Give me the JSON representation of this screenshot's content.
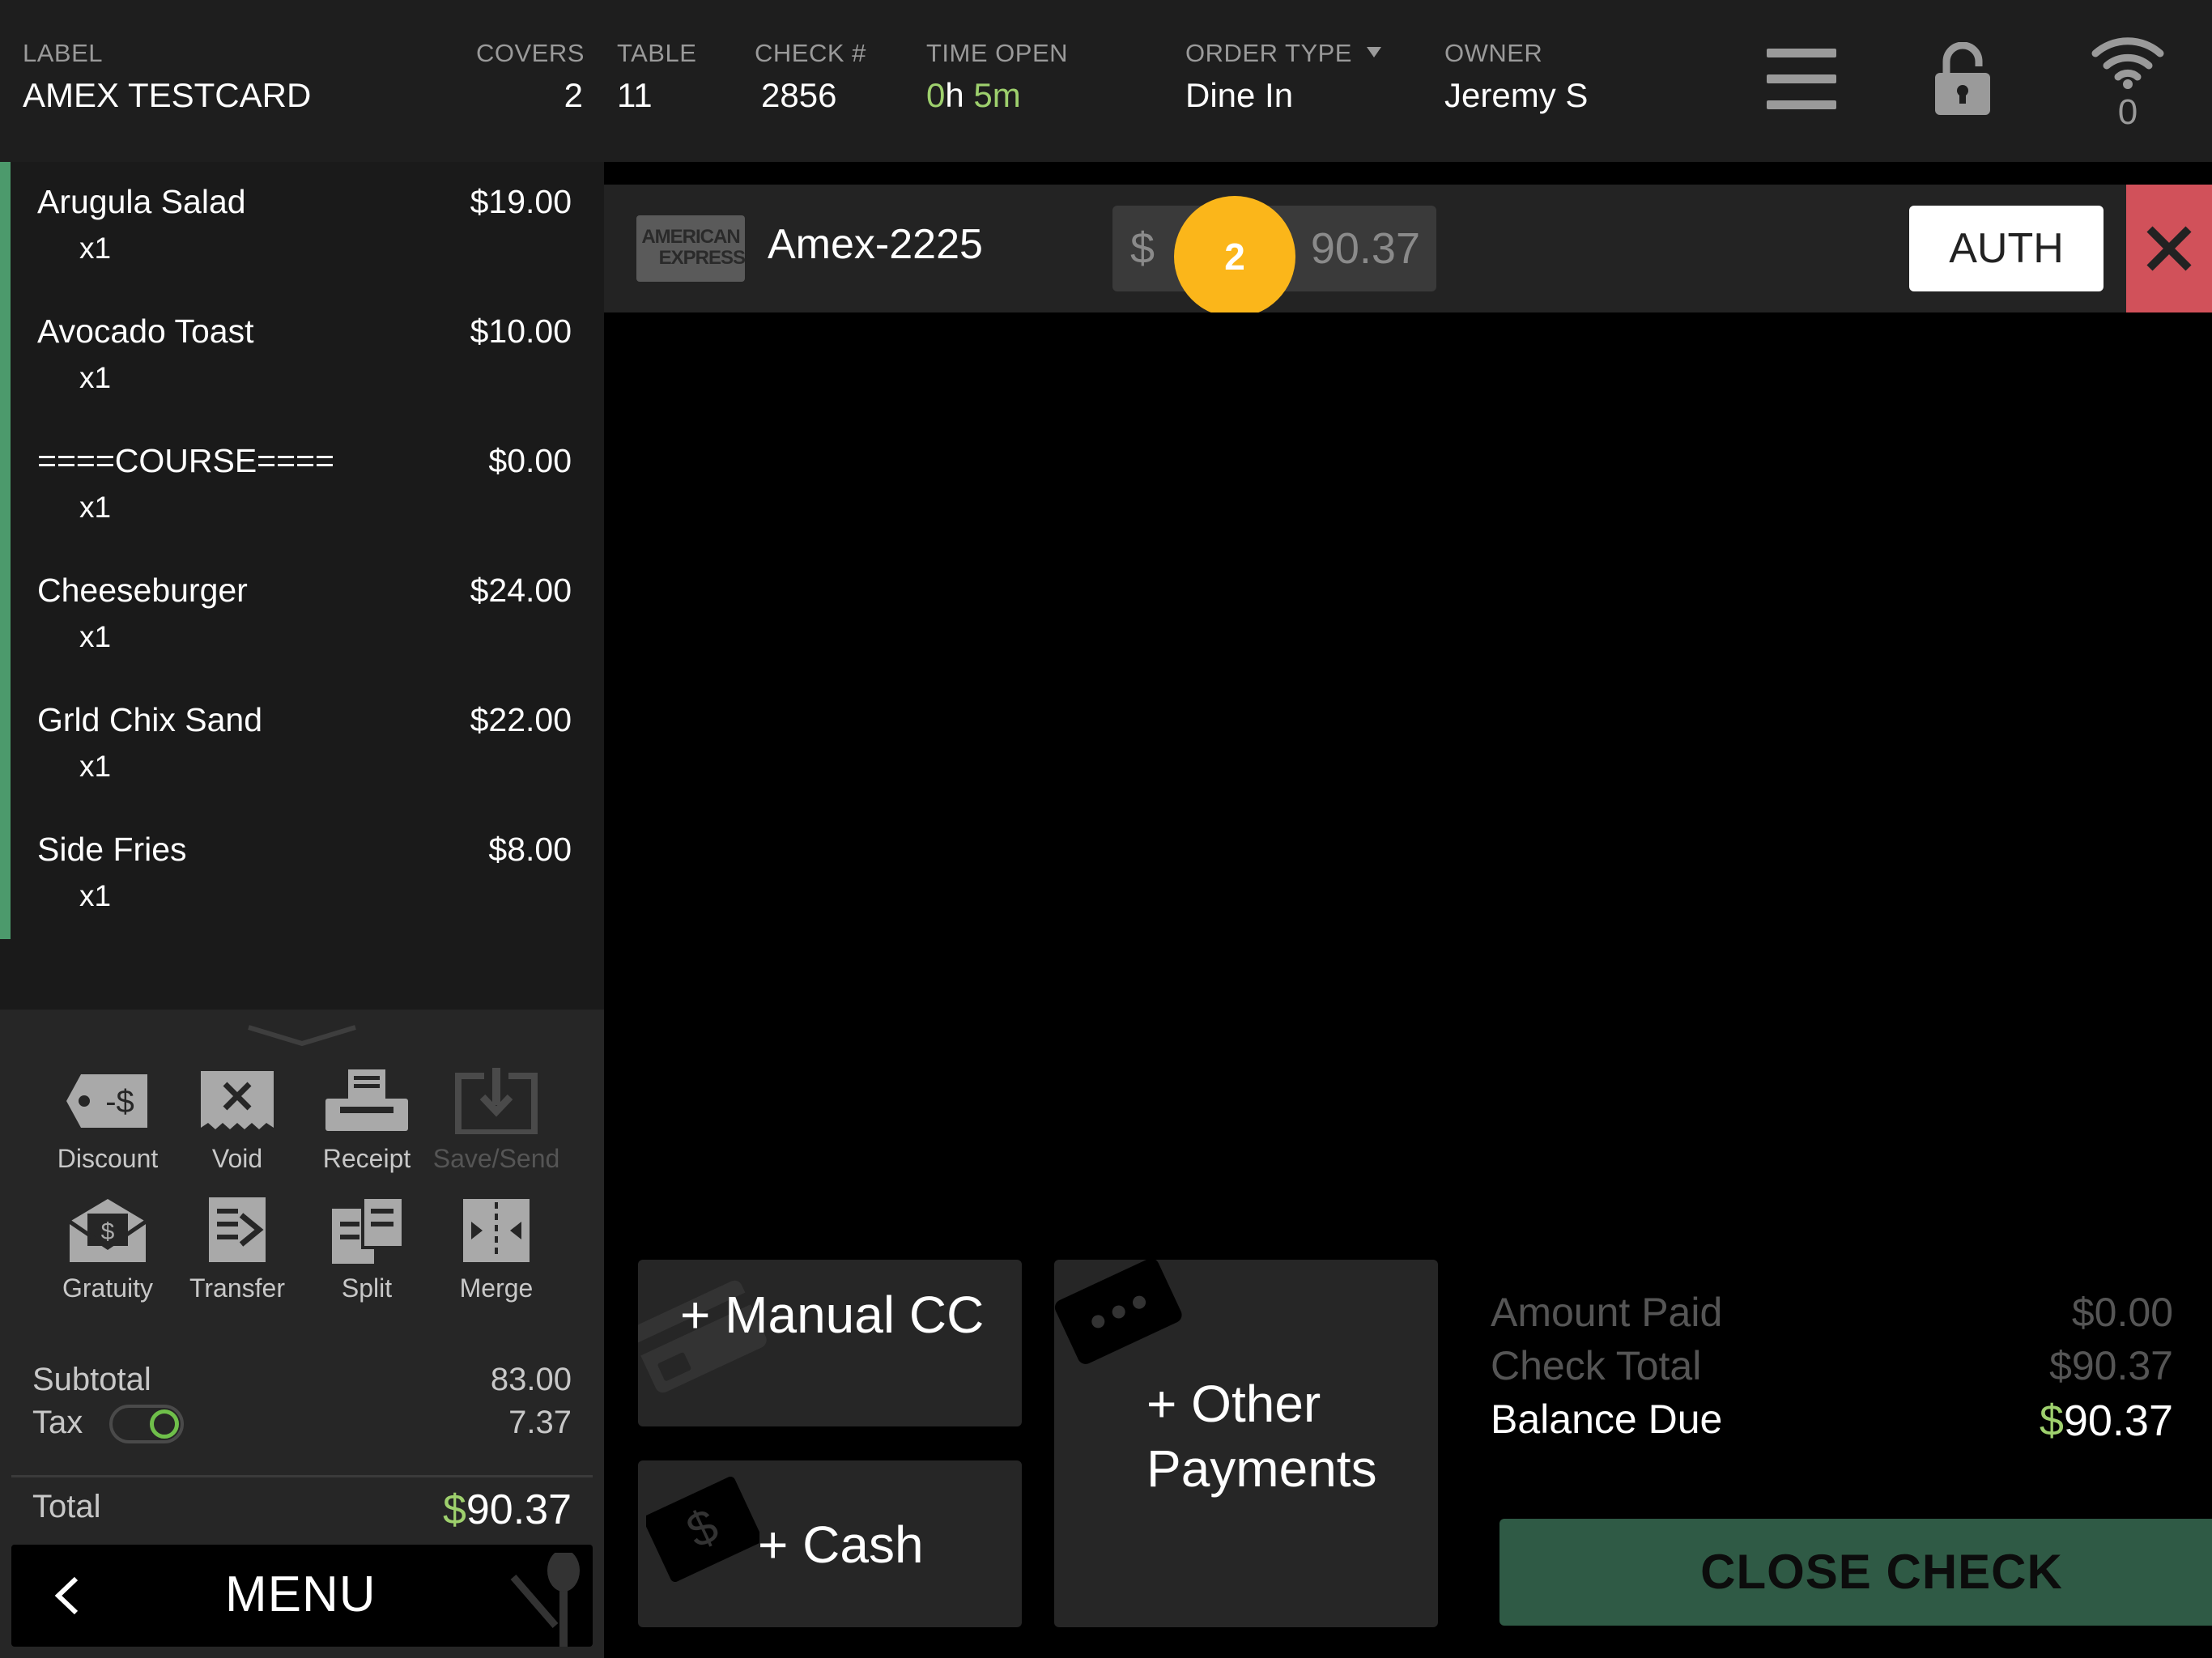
{
  "header": {
    "label_caption": "LABEL",
    "label_value": "AMEX TESTCARD",
    "covers_caption": "COVERS",
    "covers_value": "2",
    "table_caption": "TABLE",
    "table_value": "11",
    "check_caption": "CHECK #",
    "check_value": "2856",
    "time_caption": "TIME OPEN",
    "time_hours": "0",
    "time_h_unit": "h ",
    "time_minutes": "5",
    "time_m_unit": "m",
    "order_type_caption": "ORDER TYPE",
    "order_type_value": "Dine In",
    "owner_caption": "OWNER",
    "owner_value": "Jeremy S",
    "wifi_count": "0",
    "icons": {
      "menu": "hamburger-icon",
      "lock": "lock-icon",
      "wifi": "wifi-icon"
    }
  },
  "order": {
    "items": [
      {
        "name": "Arugula Salad",
        "price": "$19.00",
        "qty": "x1"
      },
      {
        "name": "Avocado Toast",
        "price": "$10.00",
        "qty": "x1"
      },
      {
        "name": "====COURSE====",
        "price": "$0.00",
        "qty": "x1"
      },
      {
        "name": "Cheeseburger",
        "price": "$24.00",
        "qty": "x1"
      },
      {
        "name": "Grld Chix Sand",
        "price": "$22.00",
        "qty": "x1"
      },
      {
        "name": "Side Fries",
        "price": "$8.00",
        "qty": "x1"
      }
    ]
  },
  "tools": {
    "discount": "Discount",
    "void": "Void",
    "receipt": "Receipt",
    "save_send": "Save/Send",
    "gratuity": "Gratuity",
    "transfer": "Transfer",
    "split": "Split",
    "merge": "Merge"
  },
  "summary": {
    "subtotal_label": "Subtotal",
    "subtotal_value": "83.00",
    "tax_label": "Tax",
    "tax_value": "7.37",
    "total_label": "Total",
    "total_currency": "$",
    "total_value": "90.37",
    "menu_label": "MENU"
  },
  "card": {
    "brand_line1": "AMERICAN",
    "brand_line2": "EXPRESS",
    "name": "Amex-2225",
    "currency": "$",
    "badge": "2",
    "amount": "90.37",
    "auth_label": "AUTH"
  },
  "payments": {
    "manual_cc": "+ Manual CC",
    "cash": "+ Cash",
    "other_line1": "+ Other",
    "other_line2": "Payments"
  },
  "totals": {
    "amount_paid_label": "Amount Paid",
    "amount_paid_value": "$0.00",
    "check_total_label": "Check Total",
    "check_total_value": "$90.37",
    "balance_due_label": "Balance Due",
    "balance_due_currency": "$",
    "balance_due_value": "90.37",
    "close_check_label": "CLOSE CHECK"
  },
  "colors": {
    "accent_green": "#9ed06d",
    "badge_yellow": "#fbb61a",
    "close_red": "#d1515a",
    "close_check_bg": "#2f5a45"
  }
}
